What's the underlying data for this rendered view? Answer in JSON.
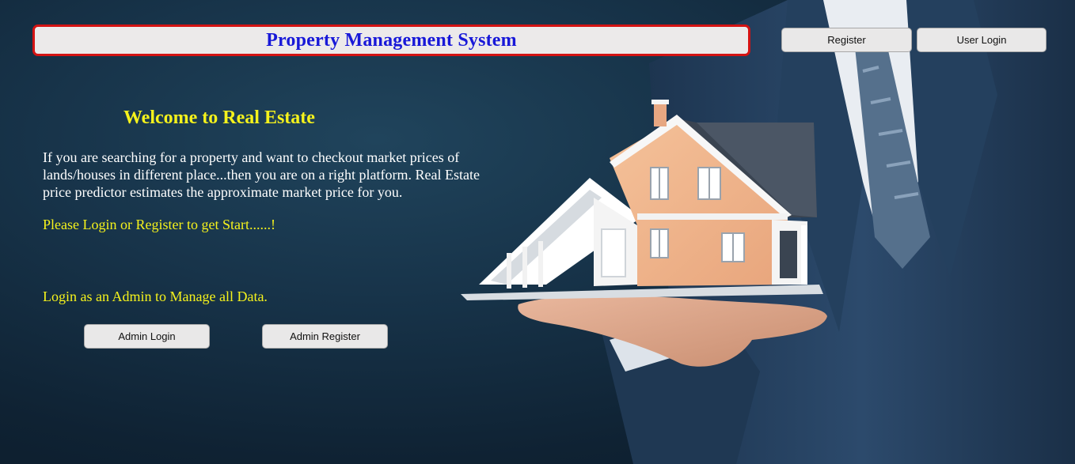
{
  "header": {
    "title": "Property Management System",
    "register_label": "Register",
    "user_login_label": "User Login"
  },
  "welcome": {
    "heading": "Welcome to Real Estate",
    "intro": "If you are searching for a property and want to checkout market prices of lands/houses in different place...then you are on a right platform. Real Estate price predictor estimates the approximate market price for you.",
    "cta": "Please Login or Register to get Start......!"
  },
  "admin": {
    "prompt": "Login as an Admin to Manage all Data.",
    "login_label": "Admin Login",
    "register_label": "Admin Register"
  },
  "colors": {
    "title_text": "#1818d8",
    "title_border": "#d41313",
    "accent_yellow": "#f5f21c",
    "background": "#173349"
  },
  "hero_image": {
    "icon": "businessman-holding-house-illustration"
  }
}
